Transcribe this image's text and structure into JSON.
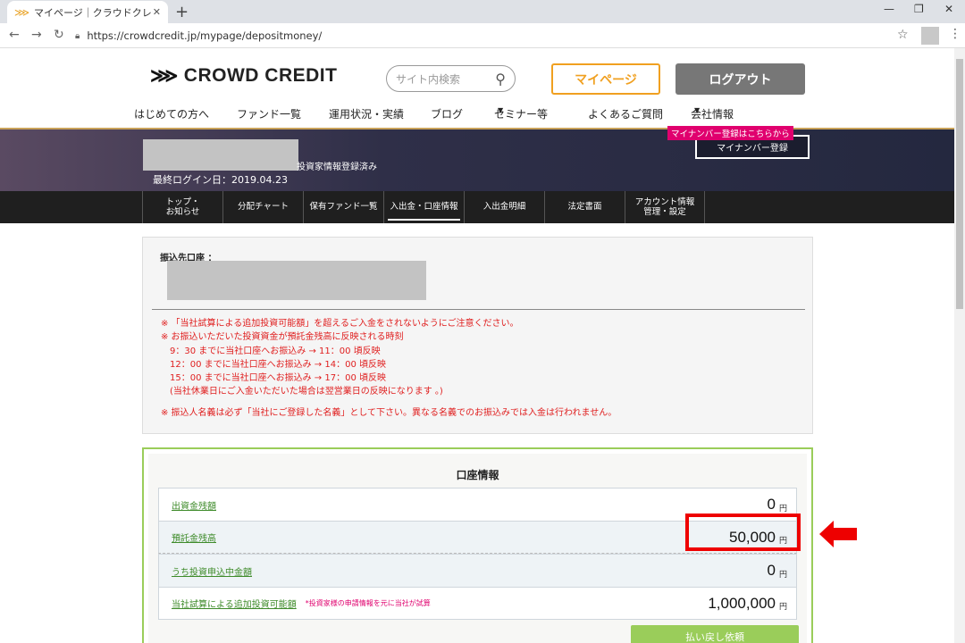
{
  "browser": {
    "tab_title": "マイページ｜クラウドクレジット",
    "url": "https://crowdcredit.jp/mypage/depositmoney/"
  },
  "header": {
    "logo": "CROWD CREDIT",
    "search_placeholder": "サイト内検索",
    "mypage_label": "マイページ",
    "logout_label": "ログアウト",
    "nav": [
      "はじめての方へ",
      "ファンド一覧",
      "運用状況・実績",
      "ブログ",
      "セミナー等",
      "よくあるご質問",
      "会社情報"
    ]
  },
  "banner": {
    "registration_status": "投資家情報登録済み",
    "last_login": "最終ログイン日：2019.04.23",
    "mynumber_tag": "マイナンバー登録はこちらから",
    "mynumber_button": "マイナンバー登録"
  },
  "subnav": [
    "トップ・\nお知らせ",
    "分配チャート",
    "保有ファンド一覧",
    "入出金・口座情報",
    "入出金明細",
    "法定書面",
    "アカウント情報\n管理・設定"
  ],
  "transfer": {
    "label": "振込先口座 ：",
    "notes": [
      "※ 「当社試算による追加投資可能額」を超えるご入金をされないようにご注意ください。",
      "※ お振込いただいた投資資金が預託金残高に反映される時刻",
      "9：30 までに当社口座へお振込み → 11：00 頃反映",
      "12：00 までに当社口座へお振込み → 14：00 頃反映",
      "15：00 までに当社口座へお振込み → 17：00 頃反映",
      "(当社休業日にご入金いただいた場合は翌営業日の反映になります 。)",
      "※ 振込人名義は必ず「当社にご登録した名義」として下さい。異なる名義でのお振込みでは入金は行われません。"
    ]
  },
  "account": {
    "title": "口座情報",
    "rows": [
      {
        "label": "出資金残額",
        "value": "0",
        "unit": "円"
      },
      {
        "label": "預託金残高",
        "value": "50,000",
        "unit": "円"
      },
      {
        "label": "うち投資申込中金額",
        "value": "0",
        "unit": "円"
      },
      {
        "label": "当社試算による追加投資可能額",
        "note": "*投資家様の申請情報を元に当社が試算",
        "value": "1,000,000",
        "unit": "円"
      }
    ],
    "refund_button": "払い戻し依頼"
  },
  "colors": {
    "accent_orange": "#f0a020",
    "accent_green": "#9acd5a",
    "alert_red": "#ee0000",
    "tag_pink": "#e0006e"
  }
}
